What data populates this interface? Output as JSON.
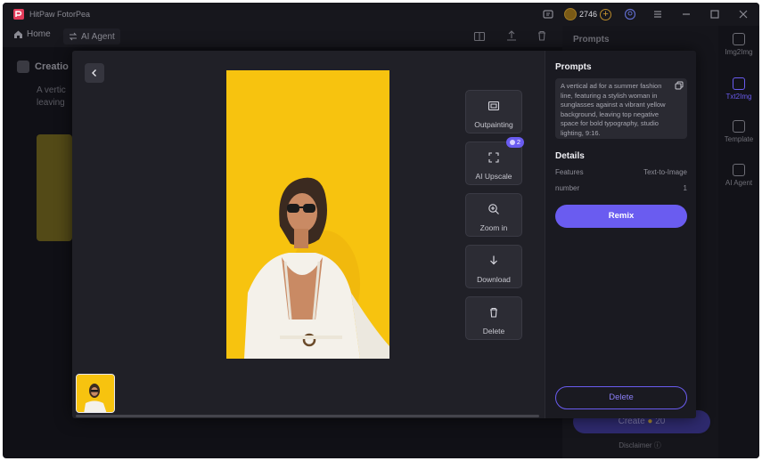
{
  "app": {
    "name": "HitPaw FotorPea"
  },
  "titlebar": {
    "credits": "2746"
  },
  "nav": {
    "home_label": "Home",
    "agent_label": "AI Agent"
  },
  "background": {
    "section_title": "Creatio",
    "text_line1": "A vertic",
    "text_line2": "leaving"
  },
  "right_panel": {
    "title": "Prompts",
    "create_label": "Create",
    "create_cost": "20",
    "disclaimer": "Disclaimer"
  },
  "side_rail": [
    {
      "label": "Img2Img"
    },
    {
      "label": "Txt2Img"
    },
    {
      "label": "Template"
    },
    {
      "label": "AI Agent"
    }
  ],
  "modal": {
    "actions": [
      {
        "label": "Outpainting",
        "icon": "outpainting-icon"
      },
      {
        "label": "AI Upscale",
        "icon": "upscale-icon",
        "badge": "2"
      },
      {
        "label": "Zoom in",
        "icon": "zoom-in-icon"
      },
      {
        "label": "Download",
        "icon": "download-icon"
      },
      {
        "label": "Delete",
        "icon": "trash-icon"
      }
    ],
    "side": {
      "prompts_title": "Prompts",
      "prompt_text": "A vertical ad for a summer fashion line, featuring a stylish woman in sunglasses against a vibrant yellow background, leaving top negative space for bold typography, studio lighting, 9:16.",
      "details_title": "Details",
      "features_label": "Features",
      "features_value": "Text-to-Image",
      "number_label": "number",
      "number_value": "1",
      "remix_label": "Remix",
      "delete_label": "Delete"
    }
  },
  "colors": {
    "accent": "#6a5cf0",
    "image_background": "#f7c30f",
    "modal_bg": "#202027"
  }
}
